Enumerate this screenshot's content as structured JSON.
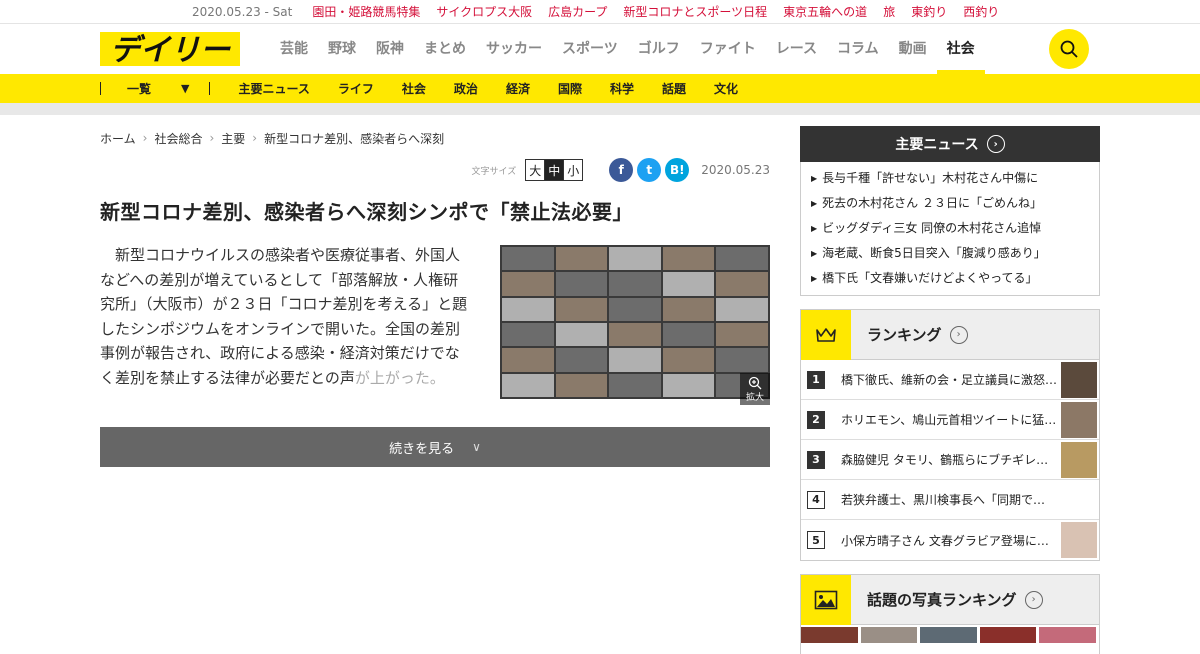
{
  "topbar": {
    "date": "2020.05.23 - Sat",
    "links": [
      "園田・姫路競馬特集",
      "サイクロプス大阪",
      "広島カープ",
      "新型コロナとスポーツ日程",
      "東京五輪への道",
      "旅",
      "東釣り",
      "西釣り"
    ]
  },
  "header": {
    "logo_text": "デイリー",
    "nav": [
      "芸能",
      "野球",
      "阪神",
      "まとめ",
      "サッカー",
      "スポーツ",
      "ゴルフ",
      "ファイト",
      "レース",
      "コラム",
      "動画",
      "社会"
    ],
    "active_nav": "社会"
  },
  "subnav": {
    "ichiran": "一覧",
    "items": [
      "主要ニュース",
      "ライフ",
      "社会",
      "政治",
      "経済",
      "国際",
      "科学",
      "話題",
      "文化"
    ]
  },
  "breadcrumb": [
    "ホーム",
    "社会総合",
    "主要",
    "新型コロナ差別、感染者らへ深刻"
  ],
  "article": {
    "fontsize_label": "文字サイズ",
    "fontsizes": [
      "大",
      "中",
      "小"
    ],
    "active_fontsize": "中",
    "share": [
      "f",
      "t",
      "B!"
    ],
    "date": "2020.05.23",
    "title": "新型コロナ差別、感染者らへ深刻シンポで「禁止法必要」",
    "body_lines": [
      "新型コロナウイルスの感染者や医療従事者、外国",
      "人などへの差別が増えているとして「部落解放・人",
      "権研究所」（大阪市）が２３日「コロナ差別を考え",
      "る」と題したシンポジウムをオンラインで開いた。",
      "全国の差別事例が報告され、政府による感染・経済",
      "対策だけでなく差別を禁止する法律が必要だとの声"
    ],
    "body_faded": "が上がった。",
    "zoom_label": "拡大",
    "more_label": "続きを見る"
  },
  "sidebar": {
    "main_news_title": "主要ニュース",
    "main_news": [
      "長与千種「許せない」木村花さん中傷に",
      "死去の木村花さん ２３日に「ごめんね」",
      "ビッグダディ三女 同僚の木村花さん追悼",
      "海老蔵、断食5日目突入「腹減り感あり」",
      "橋下氏「文春嫌いだけどよくやってる」"
    ],
    "ranking_title": "ランキング",
    "ranking": [
      {
        "num": "1",
        "text": "橋下徹氏、維新の会・足立議員に激怒…"
      },
      {
        "num": "2",
        "text": "ホリエモン、鳩山元首相ツイートに猛…"
      },
      {
        "num": "3",
        "text": "森脇健児 タモリ、鶴瓶らにブチギレ…"
      },
      {
        "num": "4",
        "text": "若狭弁護士、黒川検事長へ「同期ですから…"
      },
      {
        "num": "5",
        "text": "小保方晴子さん 文春グラビア登場に…"
      }
    ],
    "photo_ranking_title": "話題の写真ランキング"
  },
  "colors": {
    "brand_yellow": "#ffe800",
    "link_red": "#d4103a",
    "dark": "#333333"
  }
}
